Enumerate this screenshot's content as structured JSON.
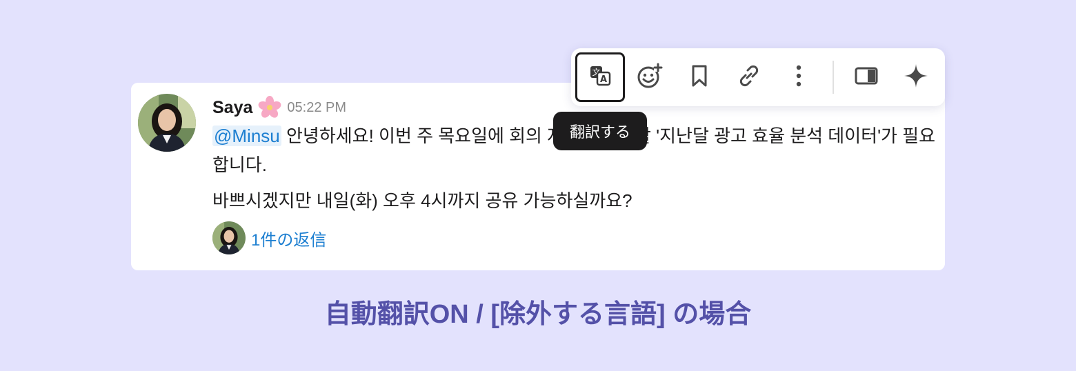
{
  "message": {
    "author": "Saya",
    "author_emoji": "cherry-blossom",
    "timestamp": "05:22 PM",
    "mention": "@Minsu",
    "line1_text": " 안녕하세요! 이번 주 목요일에 ",
    "line1_obscured_text": "",
    "line1_after_tooltip": "회의 자료에 활용할 '지난달 광고 효율 분석 데이터'가 필요합니다.",
    "paragraph2": "바쁘시겠지만 내일(화) 오후 4시까지 공유 가능하실까요?",
    "thread_replies": "1件の返信"
  },
  "toolbar": {
    "buttons": [
      {
        "icon": "translate-icon",
        "active": true
      },
      {
        "icon": "add-reaction-icon",
        "active": false
      },
      {
        "icon": "bookmark-icon",
        "active": false
      },
      {
        "icon": "link-icon",
        "active": false
      },
      {
        "icon": "more-vertical-icon",
        "active": false
      },
      {
        "icon": "sidebar-panel-icon",
        "active": false
      },
      {
        "icon": "sparkle-ai-icon",
        "active": false
      }
    ]
  },
  "tooltip": {
    "text": "翻訳する"
  },
  "caption": "自動翻訳ON / [除外する言語] の場合",
  "colors": {
    "background": "#e3e2fd",
    "mention": "#1d7fd1",
    "link": "#1d7fd1",
    "caption": "#5451a8",
    "tooltip_bg": "#1d1c1d"
  }
}
